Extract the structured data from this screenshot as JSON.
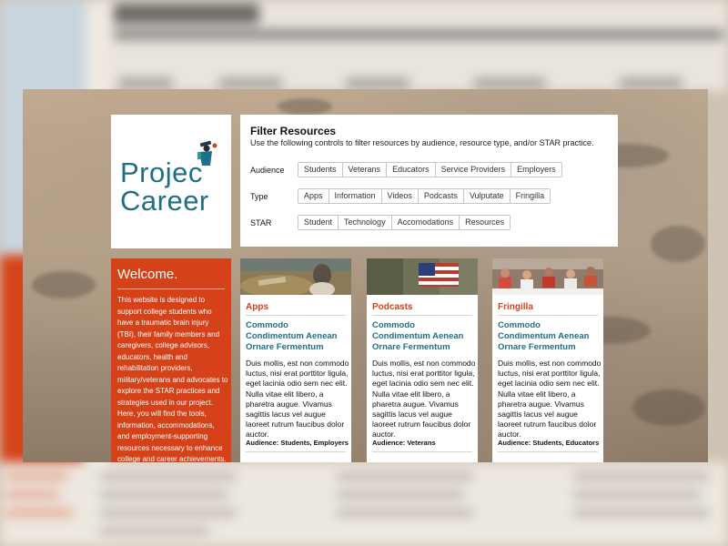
{
  "logo": {
    "text_line1": "Projec",
    "text_line2": "Career",
    "icon": "graduate-figure-icon"
  },
  "filter": {
    "title": "Filter Resources",
    "description": "Use the following controls to filter resources by audience, resource type, and/or STAR practice.",
    "rows": [
      {
        "label": "Audience",
        "options": [
          "Students",
          "Veterans",
          "Educators",
          "Service Providers",
          "Employers"
        ]
      },
      {
        "label": "Type",
        "options": [
          "Apps",
          "Information",
          "Videos",
          "Podcasts",
          "Vulputate",
          "Fringilla"
        ]
      },
      {
        "label": "STAR",
        "options": [
          "Student",
          "Technology",
          "Accomodations",
          "Resources"
        ]
      }
    ]
  },
  "welcome": {
    "heading": "Welcome.",
    "body": "This website is designed to support college students who have a traumatic brain injury (TBI), their family members and caregivers, college advisors, educators, health and rehabilitation providers, military/veterans and advocates to explore the STAR practices and strategies used in our project. Here, you will find the tools, information, accommodations, and employment-supporting resources necessary to enhance college and career achievements."
  },
  "cards": [
    {
      "category": "Apps",
      "title": "Commodo Condimentum Aenean Ornare Fermentum",
      "body": "Duis mollis, est non commodo luctus, nisi erat porttitor ligula, eget lacinia odio sem nec elit. Nulla vitae elit libero, a pharetra augue. Vivamus sagittis lacus vel augue laoreet rutrum faucibus dolor auctor.",
      "audience": "Audience: Students, Employers"
    },
    {
      "category": "Podcasts",
      "title": "Commodo Condimentum Aenean Ornare Fermentum",
      "body": "Duis mollis, est non commodo luctus, nisi erat porttitor ligula, eget lacinia odio sem nec elit. Nulla vitae elit libero, a pharetra augue. Vivamus sagittis lacus vel augue laoreet rutrum faucibus dolor auctor.",
      "audience": "Audience: Veterans"
    },
    {
      "category": "Fringilla",
      "title": "Commodo Condimentum Aenean Ornare Fermentum",
      "body": "Duis mollis, est non commodo luctus, nisi erat porttitor ligula, eget lacinia odio sem nec elit. Nulla vitae elit libero, a pharetra augue. Vivamus sagittis lacus vel augue laoreet rutrum faucibus dolor auctor.",
      "audience": "Audience: Students, Educators"
    }
  ],
  "colors": {
    "accent": "#d5421a",
    "brand_teal": "#1f6f86"
  }
}
